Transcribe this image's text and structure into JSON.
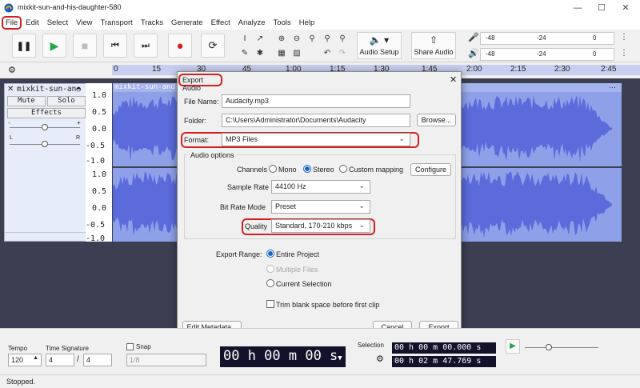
{
  "window": {
    "title": "mixkit-sun-and-his-daughter-580"
  },
  "menu": [
    "File",
    "Edit",
    "Select",
    "View",
    "Transport",
    "Tracks",
    "Generate",
    "Effect",
    "Analyze",
    "Tools",
    "Help"
  ],
  "toolbar": {
    "audio_setup": "Audio Setup",
    "share_audio": "Share Audio",
    "meter_ticks": [
      "-48",
      "-24",
      "0",
      "-48",
      "-24",
      "0"
    ]
  },
  "timeline": {
    "ticks": [
      "0",
      "15",
      "30",
      "45",
      "1:00",
      "1:15",
      "1:30",
      "1:45",
      "2:00",
      "2:15",
      "2:30",
      "2:45"
    ]
  },
  "track": {
    "name": "mixkit-sun-an◓",
    "mute": "Mute",
    "solo": "Solo",
    "effects": "Effects",
    "pan_l": "L",
    "pan_r": "R",
    "clip_title": "mixkit-sun-and-his-",
    "ruler": [
      "1.0",
      "0.5",
      "0.0",
      "-0.5",
      "-1.0",
      "1.0",
      "0.5",
      "0.0",
      "-0.5",
      "-1.0"
    ]
  },
  "dialog": {
    "title": "Export Audio",
    "close": "✕",
    "file_name_label": "File Name:",
    "file_name": "Audacity.mp3",
    "folder_label": "Folder:",
    "folder": "C:\\Users\\Administrator\\Documents\\Audacity",
    "browse": "Browse...",
    "format_label": "Format:",
    "format": "MP3 Files",
    "audio_options": "Audio options",
    "channels_label": "Channels",
    "mono": "Mono",
    "stereo": "Stereo",
    "custom": "Custom mapping",
    "configure": "Configure",
    "sample_rate_label": "Sample Rate",
    "sample_rate": "44100 Hz",
    "bitrate_mode_label": "Bit Rate Mode",
    "bitrate_mode": "Preset",
    "quality_label": "Quality",
    "quality": "Standard, 170-210 kbps",
    "export_range_label": "Export Range:",
    "range_entire": "Entire Project",
    "range_multiple": "Multiple Files",
    "range_current": "Current Selection",
    "trim_label": "Trim blank space before first clip",
    "edit_metadata": "Edit Metadata...",
    "cancel": "Cancel",
    "export": "Export"
  },
  "bottom": {
    "tempo_label": "Tempo",
    "tempo": "120",
    "time_sig_label": "Time Signature",
    "ts_num": "4",
    "ts_sep": "/",
    "ts_den": "4",
    "snap_label": "Snap",
    "snap_value": "1/8",
    "time_display": "00 h 00 m 00 s",
    "selection_label": "Selection",
    "sel_start": "00 h 00 m 00.000 s",
    "sel_end": "00 h 02 m 47.769 s"
  },
  "status": {
    "text": "Stopped."
  },
  "colors": {
    "accent": "#1a64c8",
    "highlight": "#d42020",
    "waveform": "#5b6bdc",
    "clip_bg": "#8ea0e8",
    "track_area": "#3c3f52"
  }
}
